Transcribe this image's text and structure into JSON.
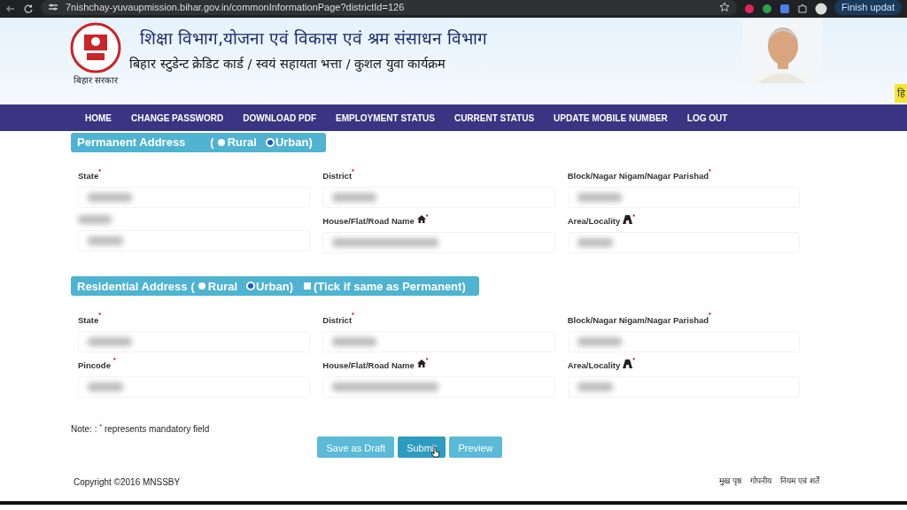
{
  "browser": {
    "url": "7nishchay-yuvaupmission.bihar.gov.in/commonInformationPage?districtId=126",
    "update_button": "Finish updat"
  },
  "header": {
    "logo_caption": "बिहार सरकार",
    "title": "शिक्षा विभाग,योजना एवं विकास एवं श्रम संसाधन विभाग",
    "subtitle": "बिहार स्टुडेन्ट क्रेडिट कार्ड / स्वयं सहायता भत्ता / कुशल युवा कार्यक्रम",
    "side_tab": "हि"
  },
  "nav": [
    "HOME",
    "CHANGE PASSWORD",
    "DOWNLOAD PDF",
    "EMPLOYMENT STATUS",
    "CURRENT STATUS",
    "UPDATE MOBILE NUMBER",
    "LOG OUT"
  ],
  "sections": [
    {
      "title": "Permanent Address",
      "open": "(",
      "radios": [
        {
          "label": "Rural",
          "selected": false
        },
        {
          "label": "Urban)",
          "selected": true
        }
      ],
      "fields": [
        {
          "kind": "select",
          "label": "State",
          "mark": "*"
        },
        {
          "kind": "select",
          "label": "District",
          "mark": "*"
        },
        {
          "kind": "select",
          "label": "Block/Nagar Nigam/Nagar Parishad",
          "mark": "*"
        },
        {
          "kind": "hidden-label"
        },
        {
          "kind": "house",
          "label": "House/Flat/Road Name",
          "mark": "*"
        },
        {
          "kind": "area",
          "label": "Area/Locality",
          "mark": "*"
        }
      ]
    },
    {
      "title": "Residential Address",
      "open": "(",
      "radios": [
        {
          "label": "Rural",
          "selected": false
        },
        {
          "label": "Urban)",
          "selected": true
        }
      ],
      "checkbox": {
        "label": "(Tick if same as Permanent)",
        "checked": false
      },
      "fields": [
        {
          "kind": "select",
          "label": "State",
          "mark": "*"
        },
        {
          "kind": "select",
          "label": "District",
          "mark": "*"
        },
        {
          "kind": "select",
          "label": "Block/Nagar Nigam/Nagar Parishad",
          "mark": "*"
        },
        {
          "kind": "input",
          "label": "Pincode",
          "mark": "*"
        },
        {
          "kind": "house",
          "label": "House/Flat/Road Name",
          "mark": "*"
        },
        {
          "kind": "area",
          "label": "Area/Locality",
          "mark": "*"
        }
      ]
    }
  ],
  "note": {
    "before": "Note: :",
    "mark": "*",
    "after": "represents mandatory field"
  },
  "buttons": [
    {
      "label": "Save as Draft",
      "kind": "plain"
    },
    {
      "label": "Submit",
      "kind": "pressed"
    },
    {
      "label": "Preview",
      "kind": "plain"
    }
  ],
  "footer": {
    "copyright": "Copyright ©2016 MNSSBY",
    "links": [
      "मुख पृष्ठ",
      "गोपनीय",
      "नियम एवं शर्तें"
    ]
  }
}
